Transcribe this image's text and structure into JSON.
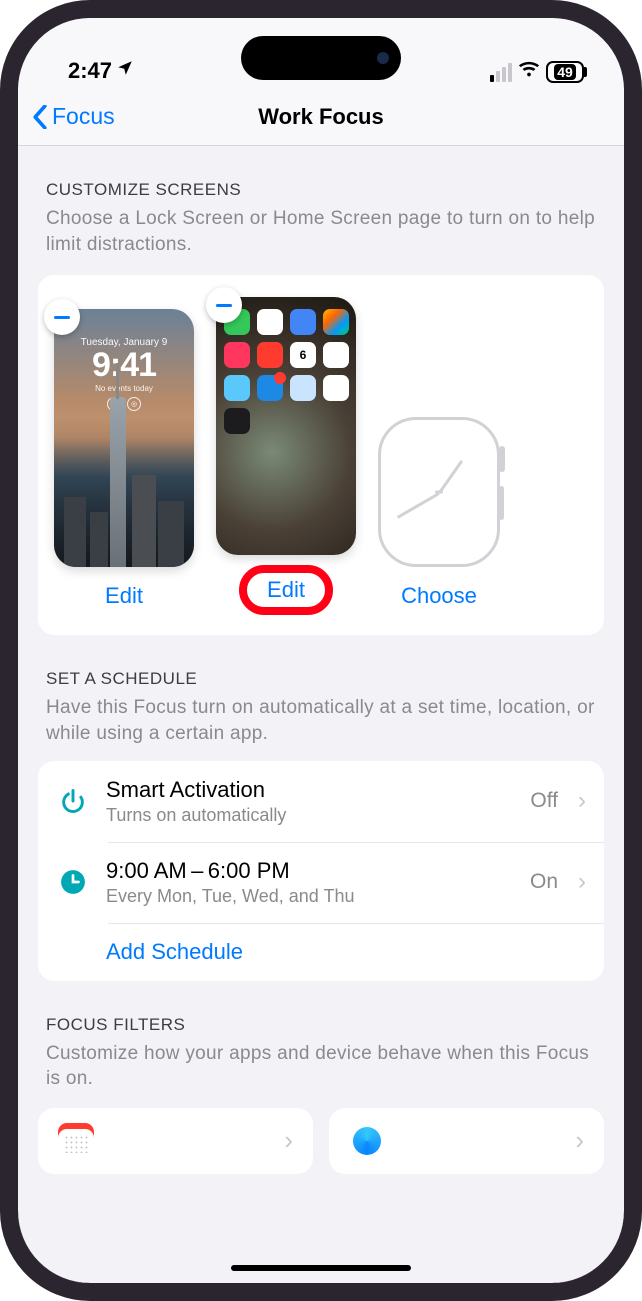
{
  "status": {
    "time": "2:47",
    "battery": "49"
  },
  "nav": {
    "back": "Focus",
    "title": "Work Focus"
  },
  "customize": {
    "title": "CUSTOMIZE SCREENS",
    "desc": "Choose a Lock Screen or Home Screen page to turn on to help limit distractions.",
    "lock": {
      "date": "Tuesday, January 9",
      "time": "9:41",
      "label": "Edit"
    },
    "home": {
      "label": "Edit",
      "cal_day": "6"
    },
    "watch": {
      "label": "Choose"
    }
  },
  "schedule": {
    "title": "SET A SCHEDULE",
    "desc": "Have this Focus turn on automatically at a set time, location, or while using a certain app.",
    "smart": {
      "title": "Smart Activation",
      "sub": "Turns on automatically",
      "value": "Off"
    },
    "time": {
      "title": "9:00 AM – 6:00 PM",
      "sub": "Every Mon, Tue, Wed, and Thu",
      "value": "On"
    },
    "add": "Add Schedule"
  },
  "filters": {
    "title": "FOCUS FILTERS",
    "desc": "Customize how your apps and device behave when this Focus is on."
  }
}
